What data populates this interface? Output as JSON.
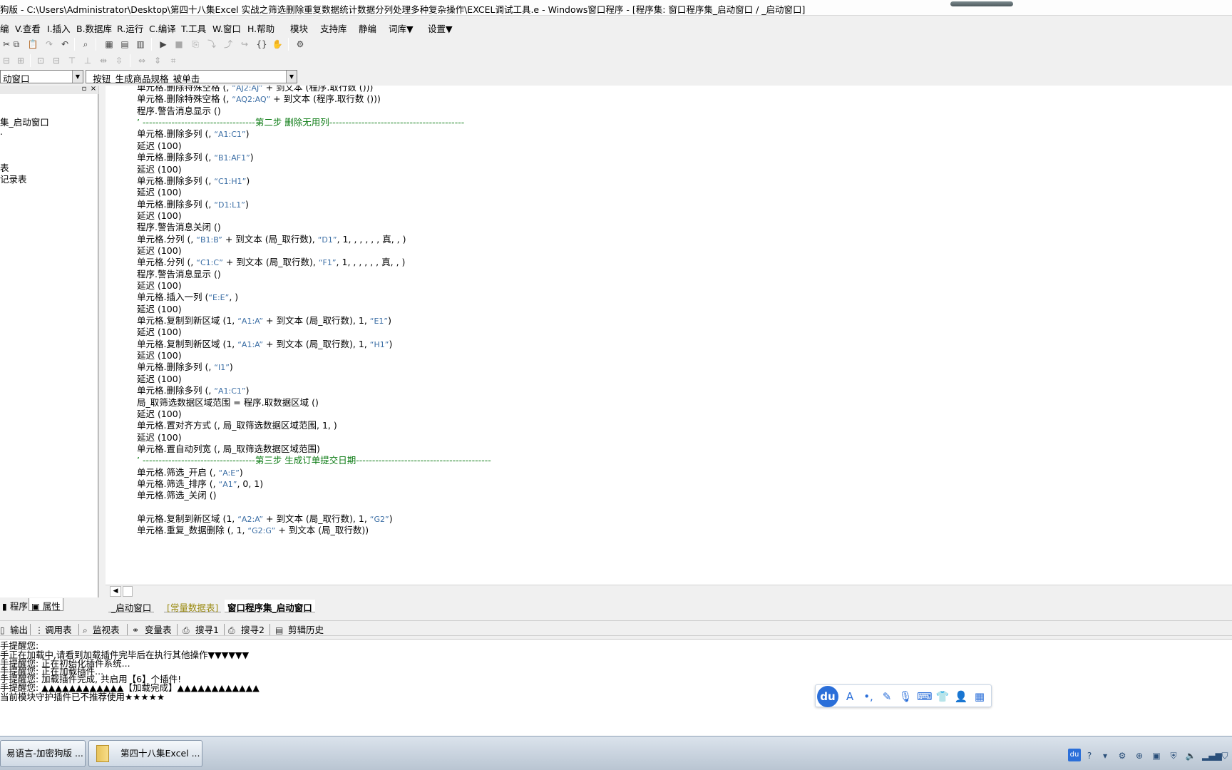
{
  "window": {
    "title": "狗版 - C:\\Users\\Administrator\\Desktop\\第四十八集Excel 实战之筛选删除重复数据统计数据分列处理多种复杂操作\\EXCEL调试工具.e - Windows窗口程序 - [程序集: 窗口程序集_启动窗口 / _启动窗口]"
  },
  "menu": {
    "items": [
      {
        "label": "编"
      },
      {
        "label": "V.查看"
      },
      {
        "label": "I.插入"
      },
      {
        "label": "B.数据库"
      },
      {
        "label": "R.运行"
      },
      {
        "label": "C.编译"
      },
      {
        "label": "T.工具"
      },
      {
        "label": "W.窗口"
      },
      {
        "label": "H.帮助"
      },
      {
        "label": "模块"
      },
      {
        "label": "支持库"
      },
      {
        "label": "静编"
      },
      {
        "label": "词库▼"
      },
      {
        "label": "设置▼"
      }
    ]
  },
  "toolbar": {
    "icons": [
      "cut-icon",
      "copy-icon",
      "paste-icon",
      "redo-icon",
      "undo-icon",
      "find-icon",
      "layout1-icon",
      "layout2-icon",
      "layout3-icon",
      "run-icon",
      "stop-icon",
      "step-icon",
      "step-into-icon",
      "step-out-icon",
      "step-over-icon",
      "braces-icon",
      "hand-icon",
      "plugin-icon"
    ],
    "row2_icons": [
      "align-left-icon",
      "align-center-icon",
      "align-right-icon",
      "align-top-icon",
      "align-middle-icon",
      "align-bottom-icon",
      "same-width-icon",
      "same-height-icon",
      "same-size-icon"
    ]
  },
  "selectors": {
    "object": "动窗口",
    "event": "_按钮_生成商品规格_被单击"
  },
  "left_panel": {
    "tree": [
      "集_启动窗口",
      ".",
      "表",
      "记录表"
    ],
    "tabs": [
      {
        "label": "程序"
      },
      {
        "label": "属性"
      }
    ]
  },
  "code": {
    "lines": [
      {
        "parts": [
          {
            "t": "单元格.删除特殊空格 (, "
          },
          {
            "t": "“AJ2:AJ”",
            "k": "s"
          },
          {
            "t": " + 到文本 (程序.取行数 ()))"
          }
        ]
      },
      {
        "parts": [
          {
            "t": "单元格.删除特殊空格 (, "
          },
          {
            "t": "“AQ2:AQ”",
            "k": "s"
          },
          {
            "t": " + 到文本 (程序.取行数 ()))"
          }
        ]
      },
      {
        "parts": [
          {
            "t": "程序.警告消息显示 ()"
          }
        ]
      },
      {
        "parts": [
          {
            "t": "’ -----------------------------------第二步 删除无用列------------------------------------------",
            "k": "c"
          }
        ]
      },
      {
        "parts": [
          {
            "t": "单元格.删除多列 (, "
          },
          {
            "t": "“A1:C1”",
            "k": "s"
          },
          {
            "t": ")"
          }
        ]
      },
      {
        "parts": [
          {
            "t": "延迟 (100)"
          }
        ]
      },
      {
        "parts": [
          {
            "t": "单元格.删除多列 (, "
          },
          {
            "t": "“B1:AF1”",
            "k": "s"
          },
          {
            "t": ")"
          }
        ]
      },
      {
        "parts": [
          {
            "t": "延迟 (100)"
          }
        ]
      },
      {
        "parts": [
          {
            "t": "单元格.删除多列 (, "
          },
          {
            "t": "“C1:H1”",
            "k": "s"
          },
          {
            "t": ")"
          }
        ]
      },
      {
        "parts": [
          {
            "t": "延迟 (100)"
          }
        ]
      },
      {
        "parts": [
          {
            "t": "单元格.删除多列 (, "
          },
          {
            "t": "“D1:L1”",
            "k": "s"
          },
          {
            "t": ")"
          }
        ]
      },
      {
        "parts": [
          {
            "t": "延迟 (100)"
          }
        ]
      },
      {
        "parts": [
          {
            "t": "程序.警告消息关闭 ()"
          }
        ]
      },
      {
        "parts": [
          {
            "t": "单元格.分列 (, "
          },
          {
            "t": "“B1:B”",
            "k": "s"
          },
          {
            "t": " + 到文本 (局_取行数), "
          },
          {
            "t": "“D1”",
            "k": "s"
          },
          {
            "t": ", 1, , , , , , 真, , )"
          }
        ]
      },
      {
        "parts": [
          {
            "t": "延迟 (100)"
          }
        ]
      },
      {
        "parts": [
          {
            "t": "单元格.分列 (, "
          },
          {
            "t": "“C1:C”",
            "k": "s"
          },
          {
            "t": " + 到文本 (局_取行数), "
          },
          {
            "t": "“F1”",
            "k": "s"
          },
          {
            "t": ", 1, , , , , , 真, , )"
          }
        ]
      },
      {
        "parts": [
          {
            "t": "程序.警告消息显示 ()"
          }
        ]
      },
      {
        "parts": [
          {
            "t": "延迟 (100)"
          }
        ]
      },
      {
        "parts": [
          {
            "t": "单元格.插入一列 ("
          },
          {
            "t": "“E:E”",
            "k": "s"
          },
          {
            "t": ", )"
          }
        ]
      },
      {
        "parts": [
          {
            "t": "延迟 (100)"
          }
        ]
      },
      {
        "parts": [
          {
            "t": "单元格.复制到新区域 (1, "
          },
          {
            "t": "“A1:A”",
            "k": "s"
          },
          {
            "t": " + 到文本 (局_取行数), 1, "
          },
          {
            "t": "“E1”",
            "k": "s"
          },
          {
            "t": ")"
          }
        ]
      },
      {
        "parts": [
          {
            "t": "延迟 (100)"
          }
        ]
      },
      {
        "parts": [
          {
            "t": "单元格.复制到新区域 (1, "
          },
          {
            "t": "“A1:A”",
            "k": "s"
          },
          {
            "t": " + 到文本 (局_取行数), 1, "
          },
          {
            "t": "“H1”",
            "k": "s"
          },
          {
            "t": ")"
          }
        ]
      },
      {
        "parts": [
          {
            "t": "延迟 (100)"
          }
        ]
      },
      {
        "parts": [
          {
            "t": "单元格.删除多列 (, "
          },
          {
            "t": "“I1”",
            "k": "s"
          },
          {
            "t": ")"
          }
        ]
      },
      {
        "parts": [
          {
            "t": "延迟 (100)"
          }
        ]
      },
      {
        "parts": [
          {
            "t": "单元格.删除多列 (, "
          },
          {
            "t": "“A1:C1”",
            "k": "s"
          },
          {
            "t": ")"
          }
        ]
      },
      {
        "parts": [
          {
            "t": "局_取筛选数据区域范围 = 程序.取数据区域 ()"
          }
        ]
      },
      {
        "parts": [
          {
            "t": "延迟 (100)"
          }
        ]
      },
      {
        "parts": [
          {
            "t": "单元格.置对齐方式 (, 局_取筛选数据区域范围, 1, )"
          }
        ]
      },
      {
        "parts": [
          {
            "t": "延迟 (100)"
          }
        ]
      },
      {
        "parts": [
          {
            "t": "单元格.置自动列宽 (, 局_取筛选数据区域范围)"
          }
        ]
      },
      {
        "parts": [
          {
            "t": "’ -----------------------------------第三步 生成订单提交日期------------------------------------------",
            "k": "c"
          }
        ]
      },
      {
        "parts": [
          {
            "t": "单元格.筛选_开启 (, "
          },
          {
            "t": "“A:E”",
            "k": "s"
          },
          {
            "t": ")"
          }
        ]
      },
      {
        "parts": [
          {
            "t": "单元格.筛选_排序 (, "
          },
          {
            "t": "“A1”",
            "k": "s"
          },
          {
            "t": ", 0, 1)"
          }
        ]
      },
      {
        "parts": [
          {
            "t": "单元格.筛选_关闭 ()"
          }
        ]
      },
      {
        "parts": [
          {
            "t": ""
          }
        ]
      },
      {
        "parts": [
          {
            "t": "单元格.复制到新区域 (1, "
          },
          {
            "t": "“A2:A”",
            "k": "s"
          },
          {
            "t": " + 到文本 (局_取行数), 1, "
          },
          {
            "t": "“G2”",
            "k": "s"
          },
          {
            "t": ")"
          }
        ]
      },
      {
        "parts": [
          {
            "t": "单元格.重复_数据删除 (, 1, "
          },
          {
            "t": "“G2:G”",
            "k": "s"
          },
          {
            "t": " + 到文本 (局_取行数))"
          }
        ]
      }
    ]
  },
  "code_tabs": [
    {
      "label": "_启动窗口",
      "style": "normal"
    },
    {
      "label": "[常量数据表]",
      "style": "olive"
    },
    {
      "label": "窗口程序集_启动窗口",
      "style": "active"
    }
  ],
  "output_tabs": [
    {
      "label": "输出",
      "icon": "output-icon"
    },
    {
      "label": "调用表",
      "icon": "call-table-icon"
    },
    {
      "label": "监视表",
      "icon": "watch-icon"
    },
    {
      "label": "变量表",
      "icon": "variables-icon"
    },
    {
      "label": "搜寻1",
      "icon": "search1-icon"
    },
    {
      "label": "搜寻2",
      "icon": "search2-icon"
    },
    {
      "label": "剪辑历史",
      "icon": "clip-history-icon"
    }
  ],
  "output": {
    "lines": [
      "手提醒您:",
      "手正在加载中,请看到加载插件完毕后在执行其他操作▼▼▼▼▼▼",
      "手提醒您: 正在初始化插件系统...",
      "手提醒您: 正在加载插件...",
      "手提醒您: 加载插件完成, 共启用【6】个插件!",
      "手提醒您: ▲▲▲▲▲▲▲▲▲▲▲▲【加载完成】▲▲▲▲▲▲▲▲▲▲▲▲",
      " 当前模块守护插件已不推荐使用★★★★★"
    ]
  },
  "ime": {
    "logo": "du",
    "icons": [
      "font-icon",
      "punctuation-icon",
      "pen-icon",
      "mic-icon",
      "keyboard-icon",
      "skin-icon",
      "user-icon",
      "grid-icon"
    ]
  },
  "taskbar": {
    "tasks": [
      {
        "label": "易语言-加密狗版 ..."
      },
      {
        "label": "第四十八集Excel ..."
      }
    ],
    "tray_du": "du"
  }
}
